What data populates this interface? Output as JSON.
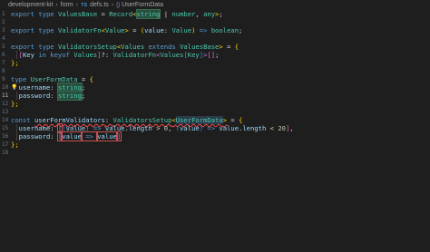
{
  "breadcrumb": {
    "items": [
      "development-kit",
      "form",
      "defs.ts",
      "UserFormData"
    ],
    "separator": "›",
    "ts_badge": "TS"
  },
  "editor": {
    "lines": [
      {
        "n": "1",
        "segs": [
          [
            "kw",
            "export "
          ],
          [
            "kw",
            "type "
          ],
          [
            "ty",
            "ValuesBase"
          ],
          [
            "pun",
            " = "
          ],
          [
            "ty",
            "Record"
          ],
          [
            "br1",
            "<"
          ],
          [
            "ty hl",
            "string"
          ],
          [
            "pun",
            " | "
          ],
          [
            "ty",
            "number"
          ],
          [
            "pun",
            ", "
          ],
          [
            "ty",
            "any"
          ],
          [
            "br1",
            ">"
          ],
          [
            "pun",
            ";"
          ]
        ]
      },
      {
        "n": "2",
        "segs": []
      },
      {
        "n": "3",
        "segs": [
          [
            "kw",
            "export "
          ],
          [
            "kw",
            "type "
          ],
          [
            "ty",
            "ValidatorFn"
          ],
          [
            "br1",
            "<"
          ],
          [
            "ty",
            "Value"
          ],
          [
            "br1",
            ">"
          ],
          [
            "pun",
            " = "
          ],
          [
            "br1",
            "("
          ],
          [
            "id",
            "value"
          ],
          [
            "pun",
            ": "
          ],
          [
            "ty",
            "Value"
          ],
          [
            "br1",
            ")"
          ],
          [
            "kw",
            " =>"
          ],
          [
            "pun",
            " "
          ],
          [
            "ty",
            "boolean"
          ],
          [
            "pun",
            ";"
          ]
        ]
      },
      {
        "n": "4",
        "segs": []
      },
      {
        "n": "5",
        "segs": [
          [
            "kw",
            "export "
          ],
          [
            "kw",
            "type "
          ],
          [
            "ty",
            "ValidatorsSetup"
          ],
          [
            "br1",
            "<"
          ],
          [
            "ty",
            "Values "
          ],
          [
            "kw",
            "extends "
          ],
          [
            "ty",
            "ValuesBase"
          ],
          [
            "br1",
            ">"
          ],
          [
            "pun",
            " = "
          ],
          [
            "br1",
            "{"
          ]
        ]
      },
      {
        "n": "6",
        "guide": true,
        "segs": [
          [
            "pun",
            "  "
          ],
          [
            "br2",
            "["
          ],
          [
            "id",
            "Key "
          ],
          [
            "kw",
            "in "
          ],
          [
            "kw",
            "keyof "
          ],
          [
            "ty",
            "Values"
          ],
          [
            "br2",
            "]"
          ],
          [
            "pun",
            "?: "
          ],
          [
            "ty",
            "ValidatorFn"
          ],
          [
            "br2",
            "<"
          ],
          [
            "ty",
            "Values"
          ],
          [
            "br3",
            "["
          ],
          [
            "ty",
            "Key"
          ],
          [
            "br3",
            "]"
          ],
          [
            "br2",
            ">"
          ],
          [
            "br2",
            "[]"
          ],
          [
            "pun",
            ";"
          ]
        ]
      },
      {
        "n": "7",
        "segs": [
          [
            "br1",
            "};"
          ]
        ]
      },
      {
        "n": "8",
        "segs": []
      },
      {
        "n": "9",
        "segs": [
          [
            "kw",
            "type "
          ],
          [
            "ty",
            "UserFormData"
          ],
          [
            "pun",
            " = "
          ],
          [
            "br1",
            "{"
          ]
        ]
      },
      {
        "n": "10",
        "bulb": true,
        "segs": [
          [
            "pun",
            "  "
          ],
          [
            "id",
            "username"
          ],
          [
            "pun",
            ": "
          ],
          [
            "ty hl",
            "string"
          ],
          [
            "pun",
            ";"
          ]
        ]
      },
      {
        "n": "11",
        "active": true,
        "guide": true,
        "segs": [
          [
            "pun",
            "  "
          ],
          [
            "id",
            "password"
          ],
          [
            "pun",
            ": "
          ],
          [
            "ty hl",
            "string"
          ],
          [
            "pun",
            ";"
          ]
        ]
      },
      {
        "n": "12",
        "segs": [
          [
            "br1",
            "};"
          ]
        ]
      },
      {
        "n": "13",
        "segs": []
      },
      {
        "n": "14",
        "segs": [
          [
            "kw",
            "const "
          ],
          [
            "id squig",
            "userFormValidators"
          ],
          [
            "pun squig",
            ": "
          ],
          [
            "ty squig",
            "ValidatorsSetup"
          ],
          [
            "br1 squig",
            "<"
          ],
          [
            "ty squig hlsel",
            "UserFormData"
          ],
          [
            "br1 squig",
            ">"
          ],
          [
            "pun",
            " = "
          ],
          [
            "br1",
            "{"
          ]
        ]
      },
      {
        "n": "15",
        "guide": true,
        "segs": [
          [
            "pun",
            "  "
          ],
          [
            "id",
            "username"
          ],
          [
            "pun",
            ": "
          ],
          [
            "br2 errbox",
            "["
          ],
          [
            "br3",
            "("
          ],
          [
            "id",
            "value"
          ],
          [
            "br3",
            ")"
          ],
          [
            "kw",
            " => "
          ],
          [
            "id",
            "value"
          ],
          [
            "pun",
            "."
          ],
          [
            "id",
            "length"
          ],
          [
            "pun",
            " > "
          ],
          [
            "num",
            "0"
          ],
          [
            "pun",
            ", "
          ],
          [
            "br3",
            "("
          ],
          [
            "id",
            "value"
          ],
          [
            "br3",
            ")"
          ],
          [
            "kw",
            " => "
          ],
          [
            "id",
            "value"
          ],
          [
            "pun",
            "."
          ],
          [
            "id",
            "length"
          ],
          [
            "pun",
            " < "
          ],
          [
            "num",
            "20"
          ],
          [
            "br2",
            "]"
          ],
          [
            "pun",
            ","
          ]
        ]
      },
      {
        "n": "16",
        "guide": true,
        "segs": [
          [
            "pun",
            "  "
          ],
          [
            "id",
            "password"
          ],
          [
            "pun",
            ": "
          ],
          [
            "br2 errbox",
            "["
          ],
          [
            "id errbox",
            "value"
          ],
          [
            "kw errbox",
            " => "
          ],
          [
            "id errbox",
            "value"
          ],
          [
            "br2 errbox",
            "]"
          ]
        ]
      },
      {
        "n": "17",
        "segs": [
          [
            "br1",
            "};"
          ]
        ]
      },
      {
        "n": "18",
        "segs": []
      }
    ]
  },
  "icons": {
    "ts_file": "typescript-file-icon",
    "symbol": "braces-symbol-icon",
    "bulb": "lightbulb-icon"
  }
}
